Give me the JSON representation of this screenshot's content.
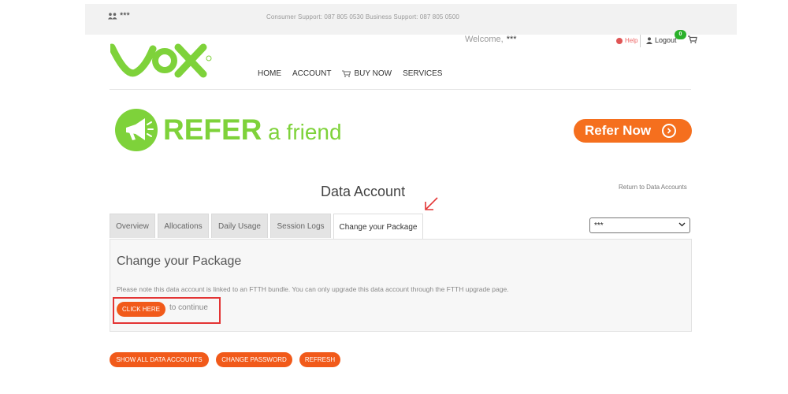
{
  "topbar": {
    "user_name": "***",
    "support_text": "Consumer Support: 087 805 0530   Business Support: 087 805 0500"
  },
  "header": {
    "brand": "VOX",
    "nav": [
      "HOME",
      "ACCOUNT",
      "BUY NOW",
      "SERVICES"
    ],
    "welcome_label": "Welcome,",
    "welcome_user": "***",
    "help_label": "Help",
    "logout_label": "Logout",
    "cart_count": "0"
  },
  "banner": {
    "refer_bold": "REFER",
    "refer_rest": " a friend",
    "refer_button": "Refer Now"
  },
  "page": {
    "title": "Data Account",
    "return_link": "Return to Data Accounts",
    "tabs": [
      {
        "label": "Overview",
        "active": false
      },
      {
        "label": "Allocations",
        "active": false
      },
      {
        "label": "Daily Usage",
        "active": false
      },
      {
        "label": "Session Logs",
        "active": false
      },
      {
        "label": "Change your Package",
        "active": true
      }
    ],
    "account_select": "***",
    "panel_heading": "Change your Package",
    "panel_note": "Please note this data account is linked to an FTTH bundle. You can only upgrade this data account through the FTTH upgrade page.",
    "click_here": "CLICK HERE",
    "continue_text": "to continue"
  },
  "actions": [
    "SHOW ALL DATA ACCOUNTS",
    "CHANGE PASSWORD",
    "REFRESH"
  ],
  "colors": {
    "brand_green": "#7ed23a",
    "accent_orange": "#f15a1a",
    "annotation_red": "#e33434"
  }
}
